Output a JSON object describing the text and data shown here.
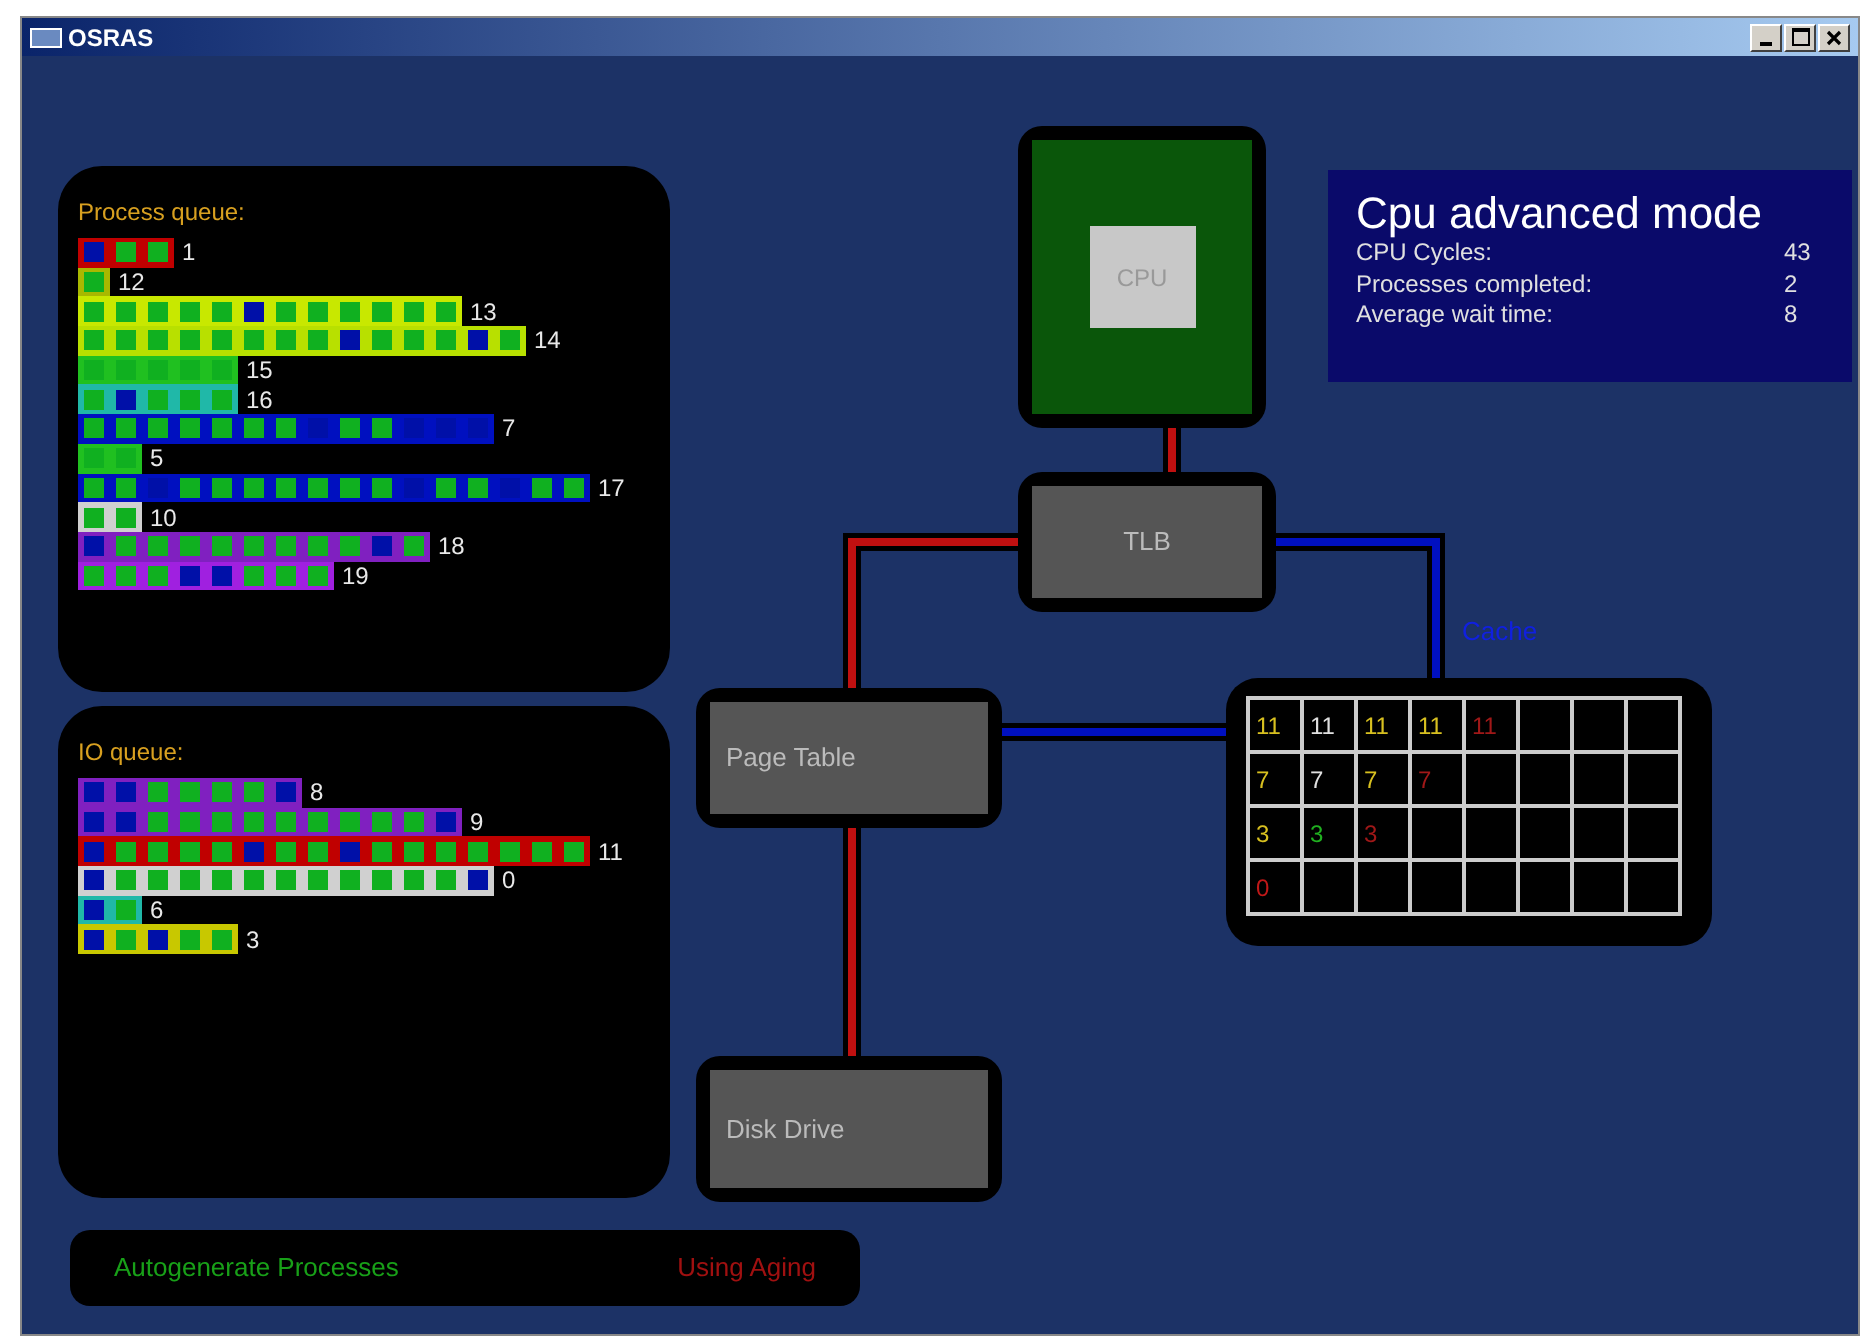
{
  "window": {
    "title": "OSRAS"
  },
  "process_queue": {
    "title": "Process queue:",
    "processes": [
      {
        "label": "1",
        "color": "#c00000",
        "blocks": [
          {
            "kind": "io"
          },
          {
            "kind": "cpu"
          },
          {
            "kind": "cpu"
          }
        ]
      },
      {
        "label": "12",
        "color": "#a8b800",
        "blocks": [
          {
            "kind": "cpu"
          }
        ]
      },
      {
        "label": "13",
        "color": "#c8e800",
        "blocks": [
          {
            "kind": "cpu"
          },
          {
            "kind": "cpu"
          },
          {
            "kind": "cpu"
          },
          {
            "kind": "cpu"
          },
          {
            "kind": "cpu"
          },
          {
            "kind": "io"
          },
          {
            "kind": "cpu"
          },
          {
            "kind": "cpu"
          },
          {
            "kind": "cpu"
          },
          {
            "kind": "cpu"
          },
          {
            "kind": "cpu"
          },
          {
            "kind": "cpu"
          }
        ]
      },
      {
        "label": "14",
        "color": "#b8e000",
        "blocks": [
          {
            "kind": "cpu"
          },
          {
            "kind": "cpu"
          },
          {
            "kind": "cpu"
          },
          {
            "kind": "cpu"
          },
          {
            "kind": "cpu"
          },
          {
            "kind": "cpu"
          },
          {
            "kind": "cpu"
          },
          {
            "kind": "cpu"
          },
          {
            "kind": "io"
          },
          {
            "kind": "cpu"
          },
          {
            "kind": "cpu"
          },
          {
            "kind": "cpu"
          },
          {
            "kind": "io"
          },
          {
            "kind": "cpu"
          }
        ]
      },
      {
        "label": "15",
        "color": "#20c020",
        "blocks": [
          {
            "kind": "cpu"
          },
          {
            "kind": "cpu"
          },
          {
            "kind": "cpu"
          },
          {
            "kind": "cpu"
          },
          {
            "kind": "cpu"
          }
        ]
      },
      {
        "label": "16",
        "color": "#20b8a8",
        "blocks": [
          {
            "kind": "cpu"
          },
          {
            "kind": "io"
          },
          {
            "kind": "cpu"
          },
          {
            "kind": "cpu"
          },
          {
            "kind": "cpu"
          }
        ]
      },
      {
        "label": "7",
        "color": "#0010c0",
        "blocks": [
          {
            "kind": "cpu"
          },
          {
            "kind": "cpu"
          },
          {
            "kind": "cpu"
          },
          {
            "kind": "cpu"
          },
          {
            "kind": "cpu"
          },
          {
            "kind": "cpu"
          },
          {
            "kind": "cpu"
          },
          {
            "kind": "io"
          },
          {
            "kind": "cpu"
          },
          {
            "kind": "cpu"
          },
          {
            "kind": "io"
          },
          {
            "kind": "io"
          },
          {
            "kind": "io"
          }
        ]
      },
      {
        "label": "5",
        "color": "#20c020",
        "blocks": [
          {
            "kind": "cpu"
          },
          {
            "kind": "cpu"
          }
        ]
      },
      {
        "label": "17",
        "color": "#0010c0",
        "blocks": [
          {
            "kind": "cpu"
          },
          {
            "kind": "cpu"
          },
          {
            "kind": "io"
          },
          {
            "kind": "cpu"
          },
          {
            "kind": "cpu"
          },
          {
            "kind": "cpu"
          },
          {
            "kind": "cpu"
          },
          {
            "kind": "cpu"
          },
          {
            "kind": "cpu"
          },
          {
            "kind": "cpu"
          },
          {
            "kind": "io"
          },
          {
            "kind": "cpu"
          },
          {
            "kind": "cpu"
          },
          {
            "kind": "io"
          },
          {
            "kind": "cpu"
          },
          {
            "kind": "cpu"
          }
        ]
      },
      {
        "label": "10",
        "color": "#d0d0d0",
        "blocks": [
          {
            "kind": "cpu"
          },
          {
            "kind": "cpu"
          }
        ]
      },
      {
        "label": "18",
        "color": "#8020c0",
        "blocks": [
          {
            "kind": "io"
          },
          {
            "kind": "cpu"
          },
          {
            "kind": "cpu"
          },
          {
            "kind": "cpu"
          },
          {
            "kind": "cpu"
          },
          {
            "kind": "cpu"
          },
          {
            "kind": "cpu"
          },
          {
            "kind": "cpu"
          },
          {
            "kind": "cpu"
          },
          {
            "kind": "io"
          },
          {
            "kind": "cpu"
          }
        ]
      },
      {
        "label": "19",
        "color": "#a020e0",
        "blocks": [
          {
            "kind": "cpu"
          },
          {
            "kind": "cpu"
          },
          {
            "kind": "cpu"
          },
          {
            "kind": "io"
          },
          {
            "kind": "io"
          },
          {
            "kind": "cpu"
          },
          {
            "kind": "cpu"
          },
          {
            "kind": "cpu"
          }
        ]
      }
    ]
  },
  "io_queue": {
    "title": "IO queue:",
    "processes": [
      {
        "label": "8",
        "color": "#8020c0",
        "blocks": [
          {
            "kind": "io"
          },
          {
            "kind": "io"
          },
          {
            "kind": "cpu"
          },
          {
            "kind": "cpu"
          },
          {
            "kind": "cpu"
          },
          {
            "kind": "cpu"
          },
          {
            "kind": "io"
          }
        ]
      },
      {
        "label": "9",
        "color": "#8020c0",
        "blocks": [
          {
            "kind": "io"
          },
          {
            "kind": "io"
          },
          {
            "kind": "cpu"
          },
          {
            "kind": "cpu"
          },
          {
            "kind": "cpu"
          },
          {
            "kind": "cpu"
          },
          {
            "kind": "cpu"
          },
          {
            "kind": "cpu"
          },
          {
            "kind": "cpu"
          },
          {
            "kind": "cpu"
          },
          {
            "kind": "cpu"
          },
          {
            "kind": "io"
          }
        ]
      },
      {
        "label": "11",
        "color": "#c00000",
        "blocks": [
          {
            "kind": "io"
          },
          {
            "kind": "cpu"
          },
          {
            "kind": "cpu"
          },
          {
            "kind": "cpu"
          },
          {
            "kind": "cpu"
          },
          {
            "kind": "io"
          },
          {
            "kind": "cpu"
          },
          {
            "kind": "cpu"
          },
          {
            "kind": "io"
          },
          {
            "kind": "cpu"
          },
          {
            "kind": "cpu"
          },
          {
            "kind": "cpu"
          },
          {
            "kind": "cpu"
          },
          {
            "kind": "cpu"
          },
          {
            "kind": "cpu"
          },
          {
            "kind": "cpu"
          }
        ]
      },
      {
        "label": "0",
        "color": "#d0d0d0",
        "blocks": [
          {
            "kind": "io"
          },
          {
            "kind": "cpu"
          },
          {
            "kind": "cpu"
          },
          {
            "kind": "cpu"
          },
          {
            "kind": "cpu"
          },
          {
            "kind": "cpu"
          },
          {
            "kind": "cpu"
          },
          {
            "kind": "cpu"
          },
          {
            "kind": "cpu"
          },
          {
            "kind": "cpu"
          },
          {
            "kind": "cpu"
          },
          {
            "kind": "cpu"
          },
          {
            "kind": "io"
          }
        ]
      },
      {
        "label": "6",
        "color": "#20b8a8",
        "blocks": [
          {
            "kind": "io"
          },
          {
            "kind": "cpu"
          }
        ]
      },
      {
        "label": "3",
        "color": "#c8c800",
        "blocks": [
          {
            "kind": "io"
          },
          {
            "kind": "cpu"
          },
          {
            "kind": "io"
          },
          {
            "kind": "cpu"
          },
          {
            "kind": "cpu"
          }
        ]
      }
    ]
  },
  "options": [
    {
      "label": "Autogenerate Processes",
      "on": true
    },
    {
      "label": "Using Aging",
      "on": false
    }
  ],
  "cpu": {
    "label": "CPU"
  },
  "stats": {
    "title": "Cpu advanced mode",
    "rows": [
      {
        "label": "CPU Cycles:",
        "value": "43"
      },
      {
        "label": "Processes completed:",
        "value": "2"
      },
      {
        "label": "Average wait time:",
        "value": "8"
      }
    ]
  },
  "tlb": {
    "label": "TLB"
  },
  "page_table": {
    "label": "Page Table"
  },
  "disk": {
    "label": "Disk Drive"
  },
  "cache": {
    "label": "Cache",
    "rows": [
      [
        {
          "value": "11",
          "color": "#d8c020"
        },
        {
          "value": "11",
          "color": "#e0e0e0"
        },
        {
          "value": "11",
          "color": "#d8c020"
        },
        {
          "value": "11",
          "color": "#d8c020"
        },
        {
          "value": "11",
          "color": "#a01818"
        },
        null,
        null,
        null
      ],
      [
        {
          "value": "7",
          "color": "#d8c020"
        },
        {
          "value": "7",
          "color": "#e0e0e0"
        },
        {
          "value": "7",
          "color": "#d8c020"
        },
        {
          "value": "7",
          "color": "#a01818"
        },
        null,
        null,
        null,
        null
      ],
      [
        {
          "value": "3",
          "color": "#d8c020"
        },
        {
          "value": "3",
          "color": "#20b020"
        },
        {
          "value": "3",
          "color": "#a01818"
        },
        null,
        null,
        null,
        null,
        null
      ],
      [
        {
          "value": "0",
          "color": "#c01818"
        },
        null,
        null,
        null,
        null,
        null,
        null,
        null
      ]
    ]
  }
}
